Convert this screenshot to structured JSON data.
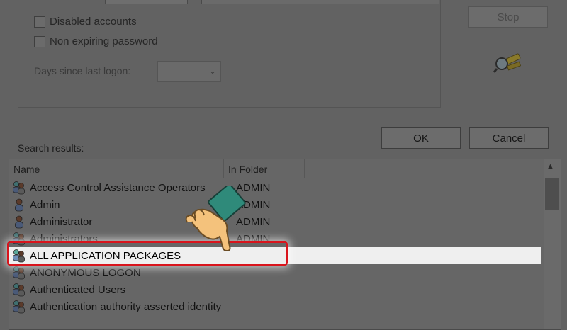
{
  "options": {
    "disabled_accounts": "Disabled accounts",
    "non_expiring_password": "Non expiring password",
    "days_since_last_logon": "Days since last logon:",
    "days_value": ""
  },
  "buttons": {
    "stop": "Stop",
    "ok": "OK",
    "cancel": "Cancel"
  },
  "results": {
    "label": "Search results:",
    "columns": [
      "Name",
      "In Folder"
    ],
    "rows": [
      {
        "name": "Access Control Assistance Operators",
        "folder": "ADMIN"
      },
      {
        "name": "Admin",
        "folder": "ADMIN"
      },
      {
        "name": "Administrator",
        "folder": "ADMIN"
      },
      {
        "name": "Administrators",
        "folder": "ADMIN"
      },
      {
        "name": "ALL APPLICATION PACKAGES",
        "folder": ""
      },
      {
        "name": "ANONYMOUS LOGON",
        "folder": ""
      },
      {
        "name": "Authenticated Users",
        "folder": ""
      },
      {
        "name": "Authentication authority asserted identity",
        "folder": ""
      }
    ],
    "selected_index": 4
  },
  "icons": {
    "search": "search-people-icon",
    "user": "user-icon",
    "group": "group-icon",
    "pointer": "hand-pointer-icon"
  },
  "colors": {
    "highlight": "#d9141c",
    "overlay": "#626262"
  }
}
